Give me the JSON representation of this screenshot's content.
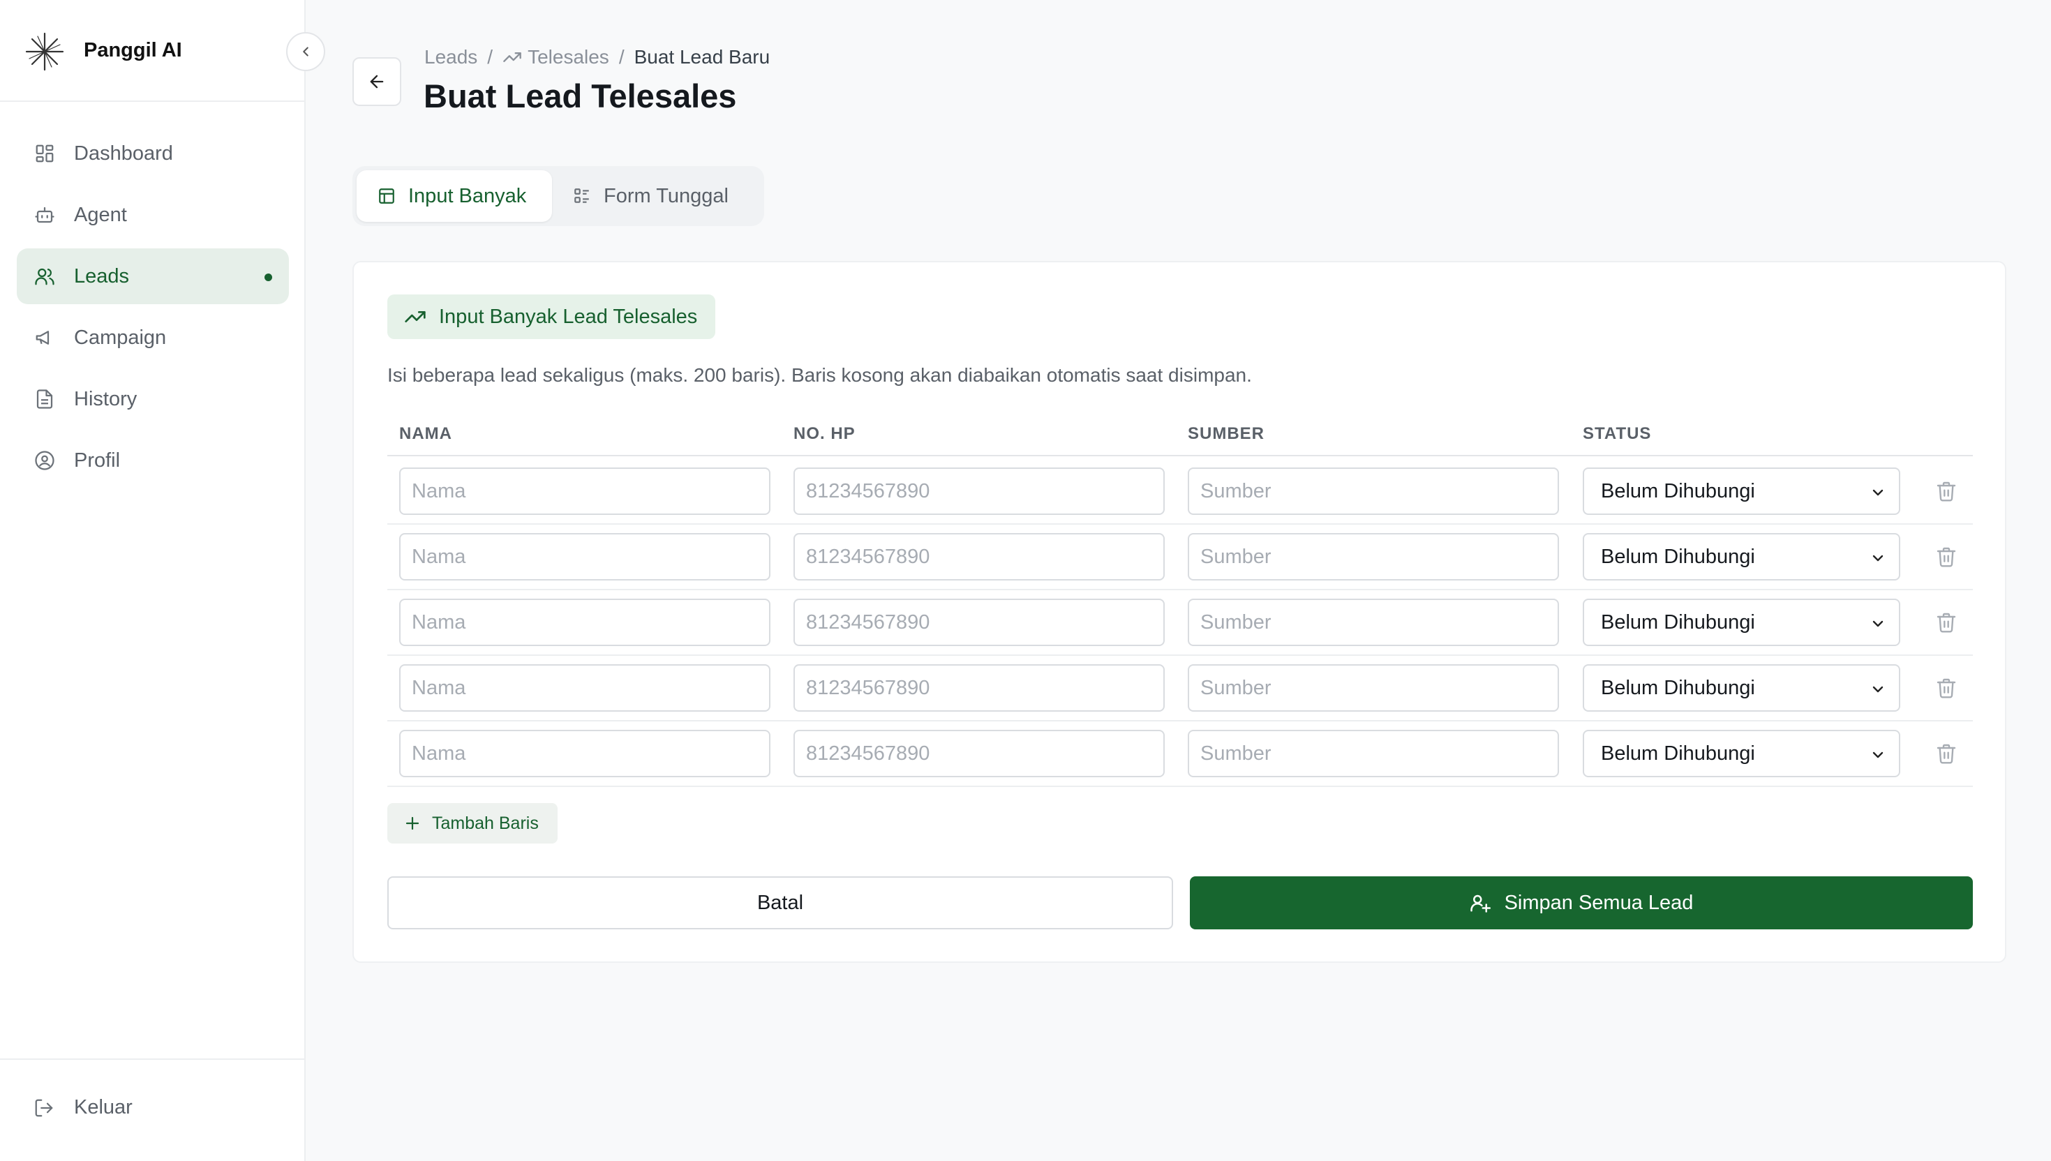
{
  "app": {
    "name": "Panggil AI"
  },
  "sidebar": {
    "items": [
      {
        "label": "Dashboard",
        "icon": "dashboard-icon",
        "active": false
      },
      {
        "label": "Agent",
        "icon": "bot-icon",
        "active": false
      },
      {
        "label": "Leads",
        "icon": "users-icon",
        "active": true
      },
      {
        "label": "Campaign",
        "icon": "megaphone-icon",
        "active": false
      },
      {
        "label": "History",
        "icon": "document-icon",
        "active": false
      },
      {
        "label": "Profil",
        "icon": "user-circle-icon",
        "active": false
      }
    ],
    "logout_label": "Keluar"
  },
  "header": {
    "breadcrumb": [
      "Leads",
      "Telesales",
      "Buat Lead Baru"
    ],
    "title": "Buat Lead Telesales"
  },
  "tabs": [
    {
      "label": "Input Banyak",
      "active": true
    },
    {
      "label": "Form Tunggal",
      "active": false
    }
  ],
  "card": {
    "chip_label": "Input Banyak Lead Telesales",
    "description": "Isi beberapa lead sekaligus (maks. 200 baris). Baris kosong akan diabaikan otomatis saat disimpan.",
    "columns": [
      "NAMA",
      "NO. HP",
      "SUMBER",
      "STATUS"
    ],
    "placeholders": {
      "name": "Nama",
      "phone": "81234567890",
      "source": "Sumber"
    },
    "rows": [
      {
        "status": "Belum Dihubungi"
      },
      {
        "status": "Belum Dihubungi"
      },
      {
        "status": "Belum Dihubungi"
      },
      {
        "status": "Belum Dihubungi"
      },
      {
        "status": "Belum Dihubungi"
      }
    ],
    "add_row_label": "Tambah Baris",
    "cancel_label": "Batal",
    "save_label": "Simpan Semua Lead"
  },
  "colors": {
    "primary": "#17662f",
    "active_bg": "#e6efe9",
    "chip_bg": "#e6f2e9"
  }
}
